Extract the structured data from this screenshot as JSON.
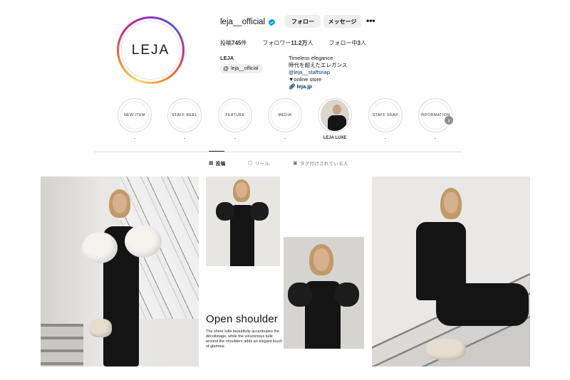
{
  "profile": {
    "avatar_text": "LEJA",
    "username": "leja__official",
    "follow_label": "フォロー",
    "message_label": "メッセージ",
    "more_label": "•••"
  },
  "stats": {
    "posts_label": "投稿",
    "posts_value": "745",
    "posts_unit": "件",
    "followers_label": "フォロワー",
    "followers_value": "11.2万",
    "followers_unit": "人",
    "following_label": "フォロー中",
    "following_value": "3",
    "following_unit": "人"
  },
  "bio": {
    "name": "LEJA",
    "threads_handle": "leja__official",
    "line1": "Timeless elegance",
    "line2": "時代を超えたエレガンス",
    "line3": "@leja__staffsnap",
    "line4": "▼online store",
    "website": "leja.jp"
  },
  "highlights": [
    {
      "title": "NEW ITEM",
      "label": "."
    },
    {
      "title": "STAFF REEL",
      "label": "."
    },
    {
      "title": "FEATURE",
      "label": "."
    },
    {
      "title": "MEDIA",
      "label": "."
    },
    {
      "title": "",
      "label": "LEJA LUXE"
    },
    {
      "title": "STAFF SNAP",
      "label": "."
    },
    {
      "title": "INFORMATION",
      "label": "."
    }
  ],
  "tabs": {
    "posts": "投稿",
    "reels": "リール",
    "tagged": "タグ付けされている人"
  },
  "posts": {
    "feature_title": "Open shoulder",
    "feature_body": "The sheer tulle beautifully accentuates the décolletage, while the voluminous tulle around the shoulders adds an elegant touch of glamour."
  },
  "colors": {
    "link": "#00376b",
    "verified": "#0095f6",
    "button_bg": "#efefef"
  }
}
